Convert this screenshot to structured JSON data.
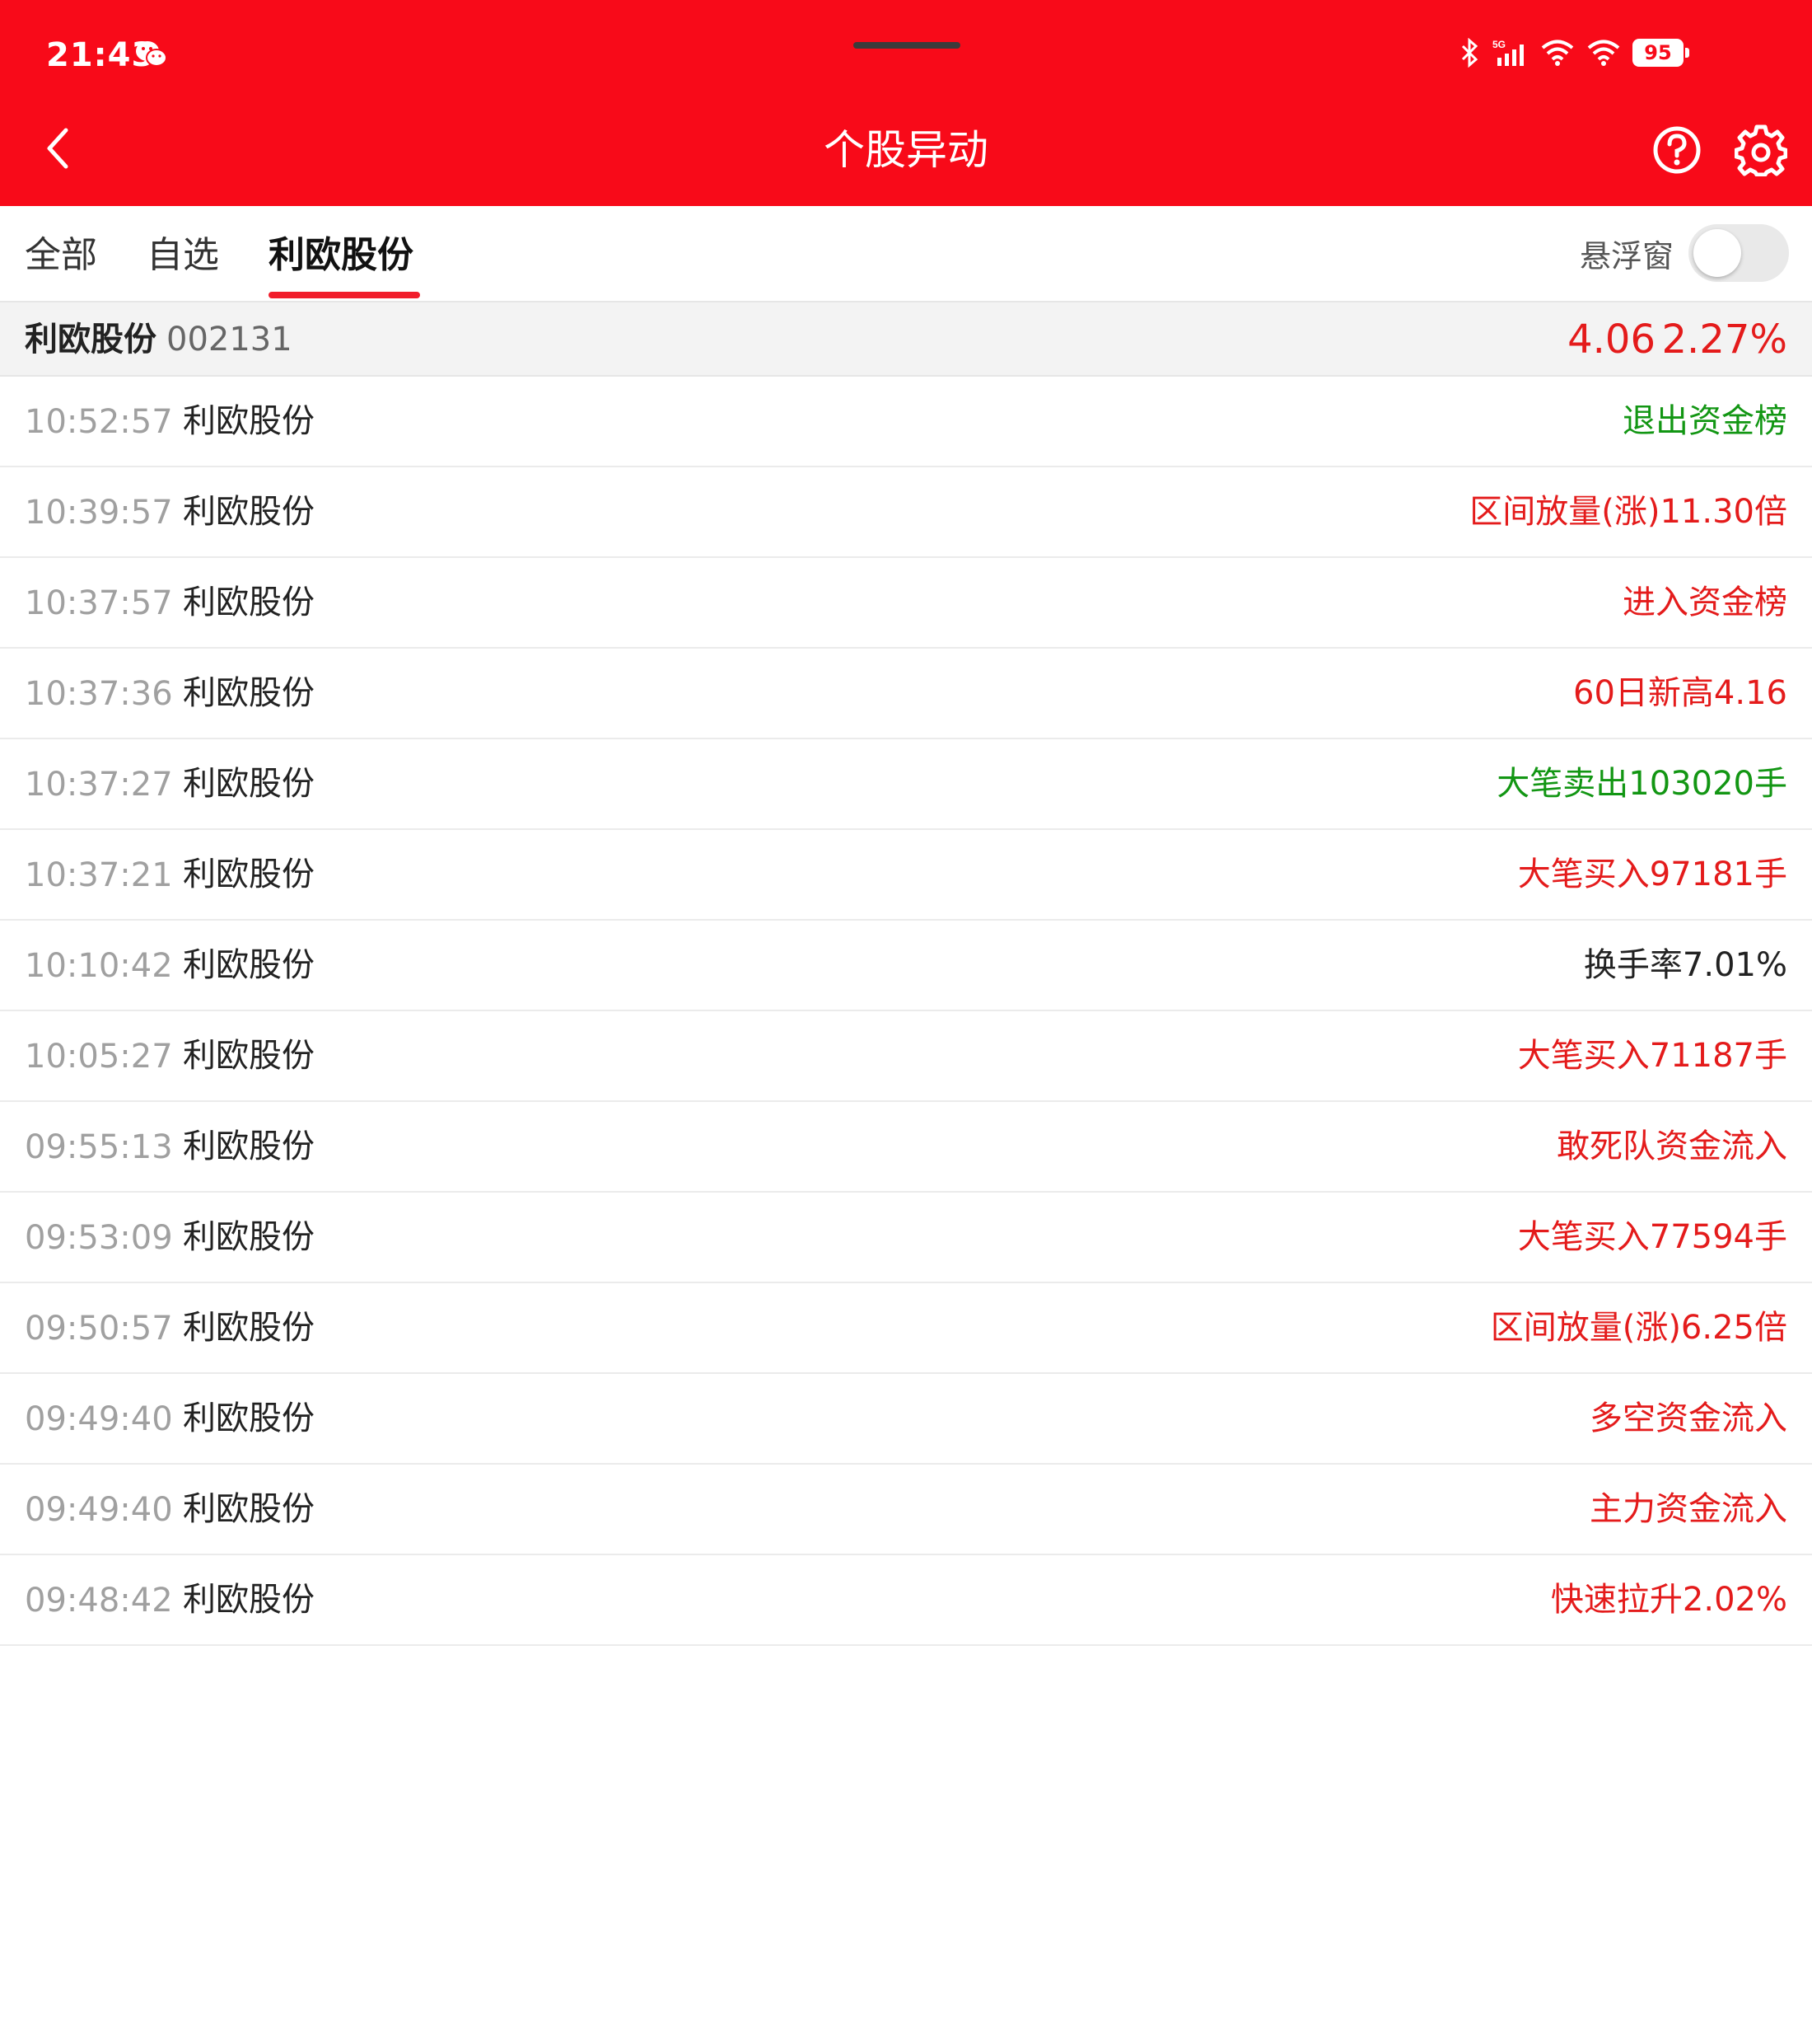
{
  "status_bar": {
    "time": "21:43",
    "battery": "95"
  },
  "nav": {
    "title": "个股异动"
  },
  "tabs": {
    "all": "全部",
    "watchlist": "自选",
    "stock": "利欧股份"
  },
  "float_window": {
    "label": "悬浮窗",
    "enabled": false
  },
  "summary": {
    "name": "利欧股份",
    "code": "002131",
    "price": "4.06",
    "change": "2.27%"
  },
  "colors": {
    "header": "#f80a19",
    "up": "#e41b1b",
    "down": "#129613",
    "neutral": "#222222"
  },
  "events": [
    {
      "time": "10:52:57",
      "name": "利欧股份",
      "event": "退出资金榜",
      "tone": "down"
    },
    {
      "time": "10:39:57",
      "name": "利欧股份",
      "event": "区间放量(涨)11.30倍",
      "tone": "up"
    },
    {
      "time": "10:37:57",
      "name": "利欧股份",
      "event": "进入资金榜",
      "tone": "up"
    },
    {
      "time": "10:37:36",
      "name": "利欧股份",
      "event": "60日新高4.16",
      "tone": "up"
    },
    {
      "time": "10:37:27",
      "name": "利欧股份",
      "event": "大笔卖出103020手",
      "tone": "down"
    },
    {
      "time": "10:37:21",
      "name": "利欧股份",
      "event": "大笔买入97181手",
      "tone": "up"
    },
    {
      "time": "10:10:42",
      "name": "利欧股份",
      "event": "换手率7.01%",
      "tone": "neutral"
    },
    {
      "time": "10:05:27",
      "name": "利欧股份",
      "event": "大笔买入71187手",
      "tone": "up"
    },
    {
      "time": "09:55:13",
      "name": "利欧股份",
      "event": "敢死队资金流入",
      "tone": "up"
    },
    {
      "time": "09:53:09",
      "name": "利欧股份",
      "event": "大笔买入77594手",
      "tone": "up"
    },
    {
      "time": "09:50:57",
      "name": "利欧股份",
      "event": "区间放量(涨)6.25倍",
      "tone": "up"
    },
    {
      "time": "09:49:40",
      "name": "利欧股份",
      "event": "多空资金流入",
      "tone": "up"
    },
    {
      "time": "09:49:40",
      "name": "利欧股份",
      "event": "主力资金流入",
      "tone": "up"
    },
    {
      "time": "09:48:42",
      "name": "利欧股份",
      "event": "快速拉升2.02%",
      "tone": "up"
    }
  ]
}
